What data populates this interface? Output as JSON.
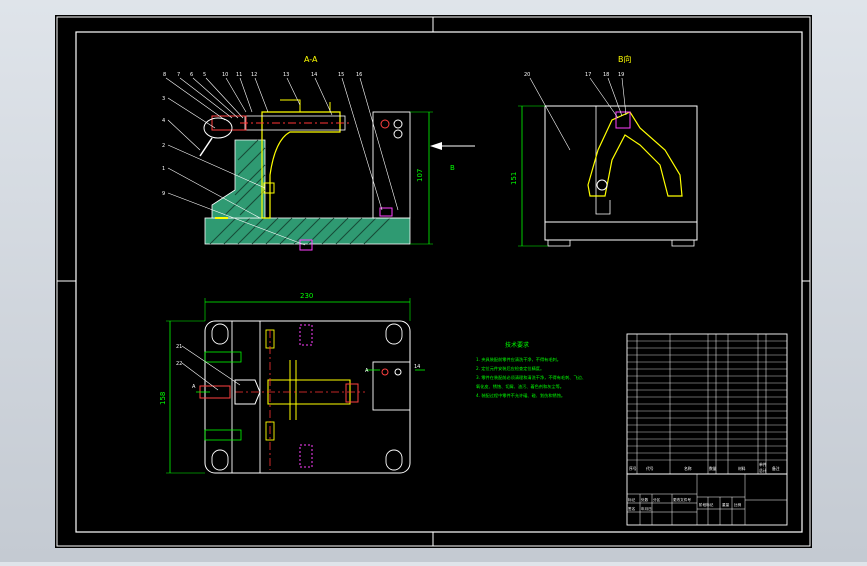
{
  "drawing": {
    "section_title": "A-A",
    "view_title": "B向",
    "direction_label": "B",
    "tech_title": "技术要求",
    "tech_lines": [
      "1. 夹具装配前零件应清洗干净，不得有毛刺。",
      "2. 定位元件安装后应检查定位精度。",
      "3. 零件在装配前必须清理和清洗干净，不得有毛刺、飞边、",
      "   氧化皮、锈蚀、切屑、油污、着色剂和灰尘等。",
      "4. 装配过程中零件不允许磕、碰、划伤和锈蚀。"
    ],
    "dims": {
      "front_height": "107",
      "top_width": "230",
      "top_height": "158",
      "view_height": "151"
    },
    "balloons_section": [
      "8",
      "7",
      "6",
      "5",
      "10",
      "11",
      "12",
      "13",
      "14",
      "15",
      "16"
    ],
    "balloons_left": [
      "3",
      "4",
      "2",
      "1",
      "9"
    ],
    "balloons_view": [
      "20",
      "17",
      "18",
      "19"
    ],
    "plan_labels": [
      "A",
      "A",
      "21",
      "22",
      "14"
    ],
    "title_block": {
      "header": [
        "序号",
        "代号",
        "名称",
        "数量",
        "材料",
        "单件",
        "总计",
        "备注"
      ],
      "rows": 18,
      "footer": [
        "标记",
        "处数",
        "分区",
        "更改文件号",
        "签名",
        "年月日",
        "阶段标记",
        "重量",
        "比例"
      ]
    }
  }
}
